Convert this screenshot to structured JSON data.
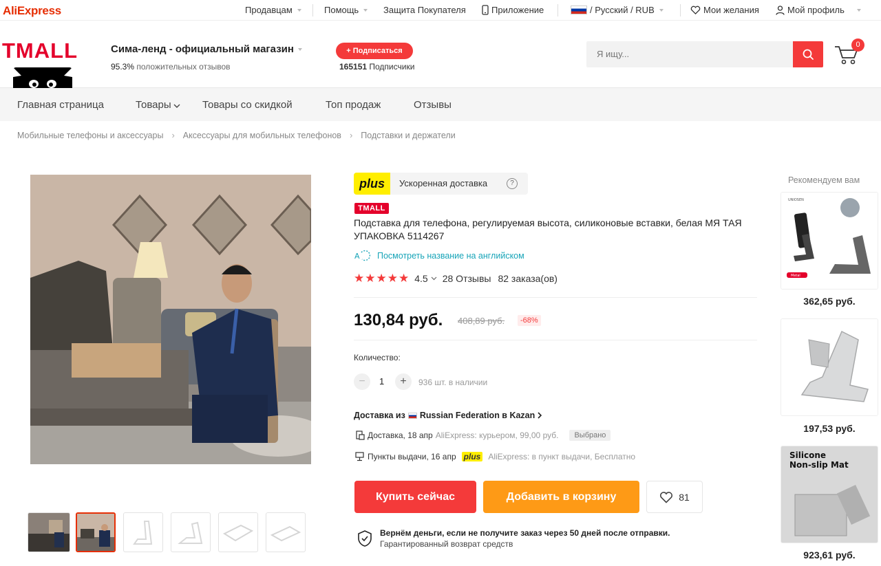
{
  "topbar": {
    "logo": "AliExpress",
    "sellers": "Продавцам",
    "help": "Помощь",
    "protection": "Защита Покупателя",
    "app": "Приложение",
    "lang_currency": "/ Русский / RUB",
    "wishlist": "Мои желания",
    "profile": "Мой профиль"
  },
  "store": {
    "brand": "TMALL",
    "name": "Сима-ленд - официальный магазин",
    "rating_value": "95.3%",
    "rating_text": "положительных отзывов",
    "subscribe_label": "+ Подписаться",
    "subscribers_count": "165151",
    "subscribers_label": "Подписчики"
  },
  "search": {
    "placeholder": "Я ищу..."
  },
  "cart": {
    "count": "0"
  },
  "nav": {
    "items": [
      "Главная страница",
      "Товары",
      "Товары со скидкой",
      "Топ продаж",
      "Отзывы"
    ]
  },
  "breadcrumb": [
    "Мобильные телефоны и аксессуары",
    "Аксессуары для мобильных телефонов",
    "Подставки и держатели"
  ],
  "product": {
    "plus_logo": "plus",
    "fast_delivery": "Ускоренная доставка",
    "help_mark": "?",
    "tmall_badge": "TMALL",
    "title": "Подставка для телефона, регулируемая высота, силиконовые вставки, белая МЯ ТАЯ УПАКОВКА 5114267",
    "english_link": "Посмотреть название на английском",
    "rating": "4.5",
    "stars_filled": 5,
    "reviews": "28 Отзывы",
    "orders": "82 заказа(ов)",
    "price": "130,84 руб.",
    "old_price": "408,89 руб.",
    "discount": "-68%",
    "quantity_label": "Количество:",
    "quantity": "1",
    "minus": "−",
    "plus": "+",
    "stock": "936 шт. в наличии",
    "ship_from_prefix": "Доставка из",
    "ship_from": "Russian Federation в Kazan",
    "delivery1_main": "Доставка, 18 апр",
    "delivery1_detail": "AliExpress: курьером, 99,00 руб.",
    "delivery1_badge": "Выбрано",
    "delivery2_main": "Пункты выдачи, 16 апр",
    "delivery2_plus": "plus",
    "delivery2_detail": "AliExpress: в пункт выдачи, Бесплатно",
    "buy_now": "Купить сейчас",
    "add_to_cart": "Добавить в корзину",
    "wish_count": "81",
    "guarantee_main": "Вернём деньги, если не получите заказ через 50 дней после отправки.",
    "guarantee_sub": "Гарантированный возврат средств"
  },
  "recommended": {
    "title": "Рекомендуем вам",
    "items": [
      {
        "price": "362,65 руб.",
        "brand": "UNIOSEN",
        "tag": "Metal"
      },
      {
        "price": "197,53 руб."
      },
      {
        "price": "923,61 руб.",
        "heading": "Silicone Non-slip Mat"
      }
    ]
  },
  "colors": {
    "accent": "#f43a3a",
    "orange": "#fe9a16",
    "plus_yellow": "#ffee00",
    "tmall_red": "#e4002b",
    "link_teal": "#17a4b8"
  }
}
